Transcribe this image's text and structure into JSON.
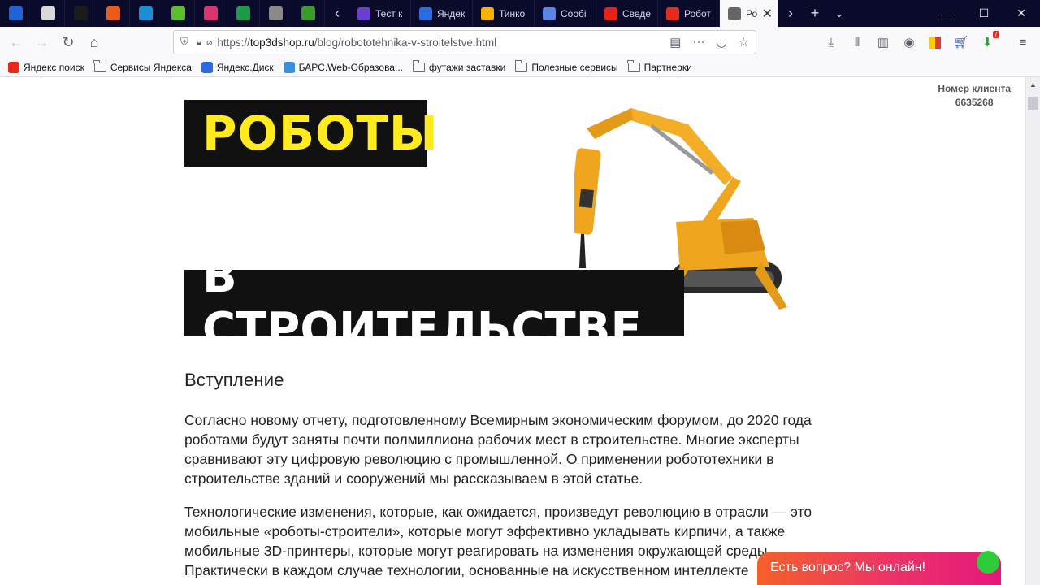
{
  "tabs": {
    "pinned": [
      {
        "icon": "mail-icon",
        "color": "#1e64d6"
      },
      {
        "icon": "chatgpt-icon",
        "color": "#d9d9d9"
      },
      {
        "icon": "pause-app-icon",
        "color": "#1b1b1b"
      },
      {
        "icon": "orange-circle-icon",
        "color": "#e85c1c"
      },
      {
        "icon": "pulse-icon",
        "color": "#1a8fd8"
      },
      {
        "icon": "green-leaf-icon",
        "color": "#5cbd2d"
      },
      {
        "icon": "ice-cream-icon",
        "color": "#d9356f"
      },
      {
        "icon": "plus-green-icon",
        "color": "#1f9a4a"
      },
      {
        "icon": "avatar-icon",
        "color": "#8a8a8a"
      },
      {
        "icon": "kt-logo-icon",
        "color": "#3a9a2a"
      }
    ],
    "open": [
      {
        "title": "Тест к",
        "icon": "form-icon",
        "color": "#6a3fd0"
      },
      {
        "title": "Яндек",
        "icon": "yandex-disk-icon",
        "color": "#2c6be0"
      },
      {
        "title": "Тинко",
        "icon": "drive-icon",
        "color": "#f4b400"
      },
      {
        "title": "Сообі",
        "icon": "chat-icon",
        "color": "#5b86e5"
      },
      {
        "title": "Сведе",
        "icon": "youtube-icon",
        "color": "#e62117"
      },
      {
        "title": "Робот",
        "icon": "yandex-icon",
        "color": "#e42b1c"
      },
      {
        "title": "Ро",
        "icon": "cube-icon",
        "color": "#666666",
        "active": true
      }
    ]
  },
  "nav": {
    "url_prefix": "https://",
    "url_host": "top3dshop.ru",
    "url_path": "/blog/robototehnika-v-stroitelstve.html"
  },
  "bookmarks": [
    {
      "label": "Яндекс поиск",
      "icon": "yandex-icon"
    },
    {
      "label": "Сервисы Яндекса",
      "icon": "folder-icon"
    },
    {
      "label": "Яндекс.Диск",
      "icon": "yandex-disk-icon"
    },
    {
      "label": "БАРС.Web-Образова...",
      "icon": "bars-icon"
    },
    {
      "label": "футажи заставки",
      "icon": "folder-icon"
    },
    {
      "label": "Полезные сервисы",
      "icon": "folder-icon"
    },
    {
      "label": "Партнерки",
      "icon": "folder-icon"
    }
  ],
  "page": {
    "client_label": "Номер клиента",
    "client_number": "6635268",
    "hero_line1": "РОБОТЫ",
    "hero_line2": "В СТРОИТЕЛЬСТВЕ",
    "heading": "Вступление",
    "para1": "Согласно новому отчету, подготовленному Всемирным экономическим форумом, до 2020 года роботами будут заняты почти полмиллиона рабочих мест в строительстве. Многие эксперты сравнивают эту цифровую революцию с промышленной. О применении робототехники в строительстве зданий и сооружений мы рассказываем в этой статье.",
    "para2": "Технологические изменения, которые, как ожидается, произведут революцию в отрасли — это мобильные «роботы-строители», которые могут эффективно укладывать кирпичи, а также мобильные 3D-принтеры, которые могут реагировать на изменения окружающей среды. Практически в каждом случае технологии, основанные на искусственном интеллекте",
    "chat_label": "Есть вопрос? Мы онлайн!"
  },
  "colors": {
    "hero_yellow": "#ffeb1e",
    "hero_black": "#111111",
    "chat_gradient_start": "#f5602a",
    "chat_gradient_end": "#e4187c",
    "online_dot": "#2ecc3a"
  }
}
